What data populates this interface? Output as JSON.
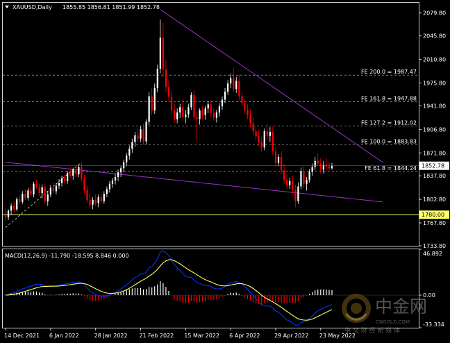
{
  "header": {
    "symbol_label": "XAUUSD,Daily",
    "ohlc_label": "1855.85 1856.81 1851.99 1852.78"
  },
  "colors": {
    "background": "#000000",
    "up_candle": "#ffffff",
    "down_candle": "#ff0000",
    "trendline": "#9933cc",
    "fib_line": "#ffffff",
    "support_line": "#ffff66",
    "current_price_tag": "#ffffff",
    "support_price_tag": "#ffff66",
    "macd_hist_up": "#ffffff",
    "macd_hist_down": "#ff0000",
    "macd_line": "#0033ff",
    "signal_line": "#ffff66"
  },
  "watermark": {
    "brand": "中金网",
    "tagline": "中 文 财 经 新 媒 体",
    "url": "CNGOLD.COM",
    "logo_icon": "gold-coin-logo-icon"
  },
  "chart_data": [
    {
      "type": "candlestick",
      "title": "XAUUSD,Daily",
      "ylim": [
        1733.8,
        2095
      ],
      "y_ticks": [
        "2079.80",
        "2045.80",
        "2010.80",
        "1975.80",
        "1941.80",
        "1906.80",
        "1871.80",
        "1837.80",
        "1802.80",
        "1767.80",
        "1733.80"
      ],
      "x_ticks": [
        "14 Dec 2021",
        "6 Jan 2022",
        "28 Jan 2022",
        "21 Feb 2022",
        "15 Mar 2022",
        "6 Apr 2022",
        "29 Apr 2022",
        "23 May 2022"
      ],
      "current_price": "1852.78",
      "support_price": "1780.00",
      "fib_levels": [
        {
          "label": "FE 200.0 = 1987.47",
          "value": 1987.47
        },
        {
          "label": "FE 161.8 = 1947.88",
          "value": 1947.88
        },
        {
          "label": "FE 127.2 = 1912.02",
          "value": 1912.02
        },
        {
          "label": "FE 100.0 = 1883.83",
          "value": 1883.83
        },
        {
          "label": "FE 61.8 = 1844.24",
          "value": 1844.24
        }
      ],
      "trendlines": [
        {
          "name": "descending resistance",
          "from": {
            "bar": 55,
            "price": 2085
          },
          "to": {
            "bar": 134,
            "price": 1858
          }
        },
        {
          "name": "lower channel",
          "from": {
            "bar": 0,
            "price": 1858
          },
          "to": {
            "bar": 134,
            "price": 1799
          }
        },
        {
          "name": "dashed support",
          "from": {
            "bar": 0,
            "price": 1761
          },
          "to": {
            "bar": 27,
            "price": 1858
          }
        }
      ],
      "candles": [
        [
          1782,
          1790,
          1770,
          1776
        ],
        [
          1776,
          1788,
          1772,
          1786
        ],
        [
          1786,
          1797,
          1780,
          1793
        ],
        [
          1793,
          1800,
          1783,
          1788
        ],
        [
          1788,
          1806,
          1785,
          1803
        ],
        [
          1803,
          1809,
          1795,
          1799
        ],
        [
          1799,
          1815,
          1796,
          1811
        ],
        [
          1811,
          1818,
          1802,
          1805
        ],
        [
          1805,
          1820,
          1801,
          1816
        ],
        [
          1816,
          1822,
          1808,
          1810
        ],
        [
          1810,
          1829,
          1806,
          1826
        ],
        [
          1826,
          1832,
          1818,
          1821
        ],
        [
          1821,
          1826,
          1808,
          1812
        ],
        [
          1812,
          1825,
          1804,
          1821
        ],
        [
          1821,
          1826,
          1796,
          1800
        ],
        [
          1800,
          1815,
          1793,
          1810
        ],
        [
          1810,
          1824,
          1806,
          1820
        ],
        [
          1820,
          1828,
          1812,
          1815
        ],
        [
          1815,
          1827,
          1810,
          1823
        ],
        [
          1823,
          1833,
          1818,
          1827
        ],
        [
          1827,
          1838,
          1822,
          1834
        ],
        [
          1834,
          1840,
          1826,
          1830
        ],
        [
          1830,
          1845,
          1826,
          1842
        ],
        [
          1842,
          1851,
          1835,
          1838
        ],
        [
          1838,
          1850,
          1832,
          1847
        ],
        [
          1847,
          1853,
          1836,
          1840
        ],
        [
          1840,
          1855,
          1836,
          1851
        ],
        [
          1851,
          1857,
          1829,
          1833
        ],
        [
          1833,
          1839,
          1812,
          1817
        ],
        [
          1817,
          1823,
          1798,
          1802
        ],
        [
          1802,
          1812,
          1790,
          1795
        ],
        [
          1795,
          1806,
          1788,
          1802
        ],
        [
          1802,
          1810,
          1793,
          1797
        ],
        [
          1797,
          1810,
          1791,
          1806
        ],
        [
          1806,
          1813,
          1797,
          1800
        ],
        [
          1800,
          1815,
          1796,
          1811
        ],
        [
          1811,
          1822,
          1806,
          1818
        ],
        [
          1818,
          1830,
          1813,
          1826
        ],
        [
          1826,
          1835,
          1820,
          1831
        ],
        [
          1831,
          1841,
          1825,
          1836
        ],
        [
          1836,
          1847,
          1830,
          1843
        ],
        [
          1843,
          1853,
          1836,
          1849
        ],
        [
          1849,
          1862,
          1843,
          1858
        ],
        [
          1858,
          1872,
          1852,
          1868
        ],
        [
          1868,
          1883,
          1862,
          1878
        ],
        [
          1878,
          1893,
          1872,
          1888
        ],
        [
          1888,
          1903,
          1881,
          1898
        ],
        [
          1898,
          1908,
          1888,
          1893
        ],
        [
          1893,
          1912,
          1888,
          1907
        ],
        [
          1907,
          1915,
          1884,
          1889
        ],
        [
          1889,
          1922,
          1885,
          1918
        ],
        [
          1918,
          1962,
          1913,
          1956
        ],
        [
          1956,
          1968,
          1928,
          1935
        ],
        [
          1935,
          1975,
          1930,
          1968
        ],
        [
          1968,
          2003,
          1962,
          1997
        ],
        [
          1997,
          2070,
          1990,
          2043
        ],
        [
          2043,
          2065,
          1985,
          1996
        ],
        [
          1996,
          2010,
          1962,
          1970
        ],
        [
          1970,
          1980,
          1948,
          1955
        ],
        [
          1955,
          1963,
          1930,
          1936
        ],
        [
          1936,
          1945,
          1916,
          1922
        ],
        [
          1922,
          1938,
          1916,
          1932
        ],
        [
          1932,
          1945,
          1924,
          1940
        ],
        [
          1940,
          1953,
          1931,
          1925
        ],
        [
          1925,
          1936,
          1916,
          1929
        ],
        [
          1929,
          1945,
          1924,
          1940
        ],
        [
          1940,
          1962,
          1936,
          1958
        ],
        [
          1958,
          1966,
          1921,
          1925
        ],
        [
          1925,
          1932,
          1890,
          1922
        ],
        [
          1922,
          1938,
          1914,
          1935
        ],
        [
          1935,
          1941,
          1922,
          1928
        ],
        [
          1928,
          1942,
          1921,
          1938
        ],
        [
          1938,
          1949,
          1931,
          1944
        ],
        [
          1944,
          1950,
          1925,
          1931
        ],
        [
          1931,
          1938,
          1920,
          1924
        ],
        [
          1924,
          1936,
          1917,
          1932
        ],
        [
          1932,
          1946,
          1926,
          1941
        ],
        [
          1941,
          1956,
          1936,
          1951
        ],
        [
          1951,
          1968,
          1946,
          1963
        ],
        [
          1963,
          1980,
          1958,
          1975
        ],
        [
          1975,
          1990,
          1968,
          1983
        ],
        [
          1983,
          1998,
          1962,
          1967
        ],
        [
          1967,
          1985,
          1961,
          1979
        ],
        [
          1979,
          1988,
          1950,
          1956
        ],
        [
          1956,
          1962,
          1941,
          1946
        ],
        [
          1946,
          1952,
          1930,
          1936
        ],
        [
          1936,
          1944,
          1922,
          1928
        ],
        [
          1928,
          1936,
          1910,
          1916
        ],
        [
          1916,
          1924,
          1898,
          1904
        ],
        [
          1904,
          1912,
          1890,
          1897
        ],
        [
          1897,
          1906,
          1882,
          1888
        ],
        [
          1888,
          1896,
          1874,
          1880
        ],
        [
          1880,
          1908,
          1876,
          1904
        ],
        [
          1904,
          1915,
          1890,
          1897
        ],
        [
          1897,
          1910,
          1888,
          1903
        ],
        [
          1903,
          1912,
          1868,
          1874
        ],
        [
          1874,
          1880,
          1851,
          1857
        ],
        [
          1857,
          1870,
          1852,
          1866
        ],
        [
          1866,
          1874,
          1840,
          1846
        ],
        [
          1846,
          1855,
          1826,
          1832
        ],
        [
          1832,
          1840,
          1818,
          1824
        ],
        [
          1824,
          1835,
          1818,
          1830
        ],
        [
          1830,
          1838,
          1812,
          1817
        ],
        [
          1817,
          1825,
          1791,
          1800
        ],
        [
          1800,
          1828,
          1796,
          1822
        ],
        [
          1822,
          1850,
          1818,
          1845
        ],
        [
          1845,
          1852,
          1820,
          1826
        ],
        [
          1826,
          1836,
          1816,
          1832
        ],
        [
          1832,
          1848,
          1828,
          1844
        ],
        [
          1844,
          1856,
          1838,
          1851
        ],
        [
          1851,
          1866,
          1846,
          1860
        ],
        [
          1860,
          1872,
          1852,
          1856
        ],
        [
          1856,
          1864,
          1841,
          1847
        ],
        [
          1847,
          1860,
          1841,
          1854
        ],
        [
          1854,
          1865,
          1846,
          1852
        ],
        [
          1852,
          1858,
          1846,
          1849
        ],
        [
          1849,
          1857,
          1847,
          1853
        ]
      ]
    },
    {
      "type": "bar",
      "title": "MACD(12,26,9) -11.790 -18.595 8.846 0.000",
      "ylim": [
        -33.334,
        46.892
      ],
      "y_ticks": [
        "46.892",
        "0.00",
        "-33.334"
      ],
      "series": [
        {
          "name": "MACD",
          "kind": "histogram"
        },
        {
          "name": "Signal",
          "kind": "line"
        }
      ]
    }
  ]
}
